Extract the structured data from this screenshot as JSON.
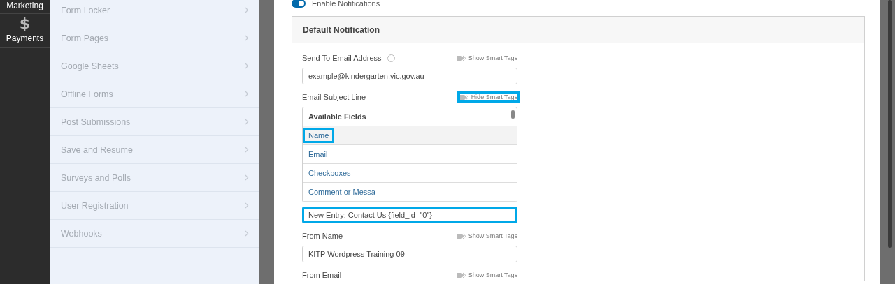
{
  "nav": [
    {
      "label": "Marketing"
    },
    {
      "label": "Payments",
      "glyph": "$"
    }
  ],
  "addons": [
    {
      "label": "Form Locker"
    },
    {
      "label": "Form Pages"
    },
    {
      "label": "Google Sheets"
    },
    {
      "label": "Offline Forms"
    },
    {
      "label": "Post Submissions"
    },
    {
      "label": "Save and Resume"
    },
    {
      "label": "Surveys and Polls"
    },
    {
      "label": "User Registration"
    },
    {
      "label": "Webhooks"
    }
  ],
  "enable_notifications": {
    "label": "Enable Notifications",
    "on": true
  },
  "section": {
    "title": "Default Notification",
    "fields": [
      {
        "label": "Send To Email Address",
        "help": true,
        "tags_toggle": "Show Smart Tags",
        "tags_highlighted": false,
        "value": "example@kindergarten.vic.gov.au"
      },
      {
        "label": "Email Subject Line",
        "help": false,
        "tags_toggle": "Hide Smart Tags",
        "tags_highlighted": true,
        "dropdown": {
          "header": "Available Fields",
          "items": [
            {
              "label": "Name",
              "hover": true,
              "highlighted": true
            },
            {
              "label": "Email",
              "hover": false,
              "highlighted": false
            },
            {
              "label": "Checkboxes",
              "hover": false,
              "highlighted": false
            },
            {
              "label": "Comment or Messa",
              "hover": false,
              "highlighted": false
            }
          ]
        },
        "value": "New Entry: Contact Us {field_id=\"0\"}",
        "value_highlighted": true
      },
      {
        "label": "From Name",
        "help": false,
        "tags_toggle": "Show Smart Tags",
        "tags_highlighted": false,
        "value": "KITP Wordpress Training 09"
      },
      {
        "label": "From Email",
        "help": false,
        "tags_toggle": "Show Smart Tags",
        "tags_highlighted": false
      }
    ]
  }
}
